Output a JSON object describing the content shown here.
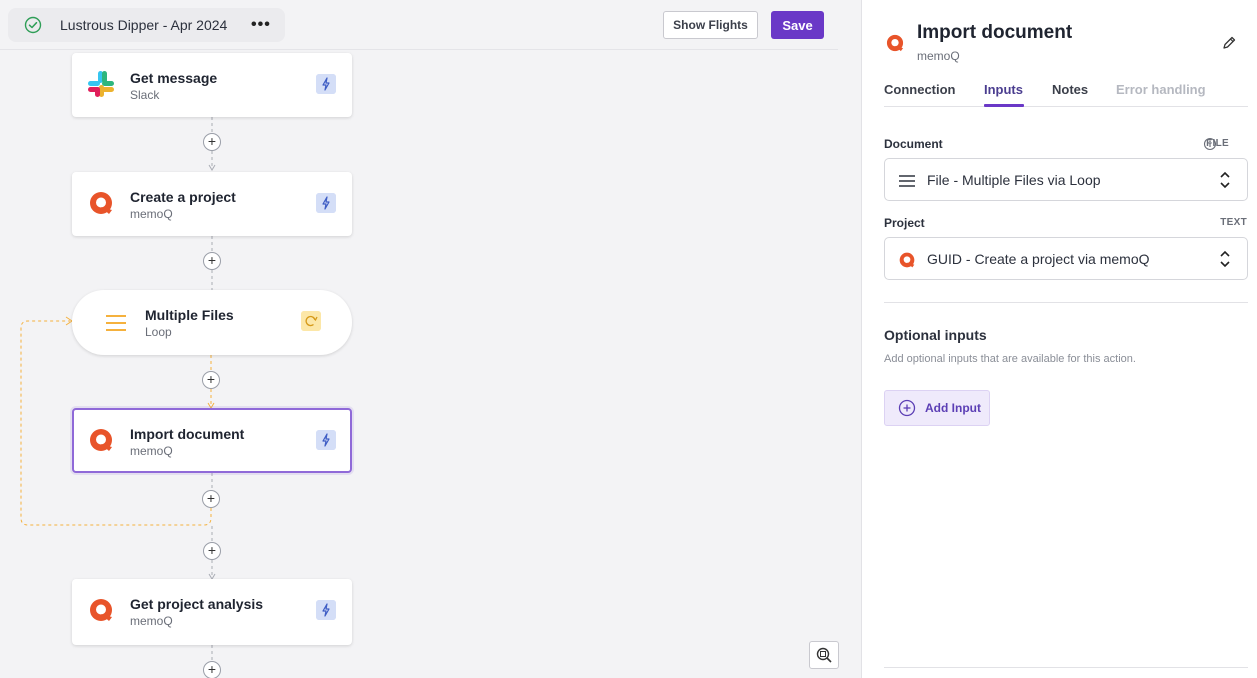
{
  "header": {
    "flow_name": "Lustrous Dipper - Apr 2024",
    "more_label": "•••",
    "show_flights_label": "Show Flights",
    "save_label": "Save"
  },
  "nodes": [
    {
      "title": "Get message",
      "subtitle": "Slack",
      "icon": "slack-logo",
      "badge": "trigger-bolt-icon"
    },
    {
      "title": "Create a project",
      "subtitle": "memoQ",
      "icon": "memoq-logo",
      "badge": "trigger-bolt-icon"
    },
    {
      "title": "Multiple Files",
      "subtitle": "Loop",
      "icon": "loop-lines-icon",
      "badge": "loop-refresh-icon"
    },
    {
      "title": "Import document",
      "subtitle": "memoQ",
      "icon": "memoq-logo",
      "badge": "trigger-bolt-icon"
    },
    {
      "title": "Get project analysis",
      "subtitle": "memoQ",
      "icon": "memoq-logo",
      "badge": "trigger-bolt-icon"
    }
  ],
  "panel": {
    "title": "Import document",
    "subtitle": "memoQ",
    "tabs": [
      {
        "label": "Connection"
      },
      {
        "label": "Inputs"
      },
      {
        "label": "Notes"
      },
      {
        "label": "Error handling"
      }
    ],
    "active_tab": "Inputs",
    "fields": [
      {
        "label": "Document",
        "type": "FILE",
        "value": "File - Multiple Files via Loop"
      },
      {
        "label": "Project",
        "type": "TEXT",
        "value": "GUID - Create a project via memoQ"
      }
    ],
    "optional": {
      "title": "Optional inputs",
      "description": "Add optional inputs that are available for this action.",
      "add_label": "Add Input"
    }
  },
  "colors": {
    "accent": "#6a38c7",
    "memoq": "#e8542a",
    "loop": "#f5b13d",
    "trigger_badge": "#d4def7"
  }
}
